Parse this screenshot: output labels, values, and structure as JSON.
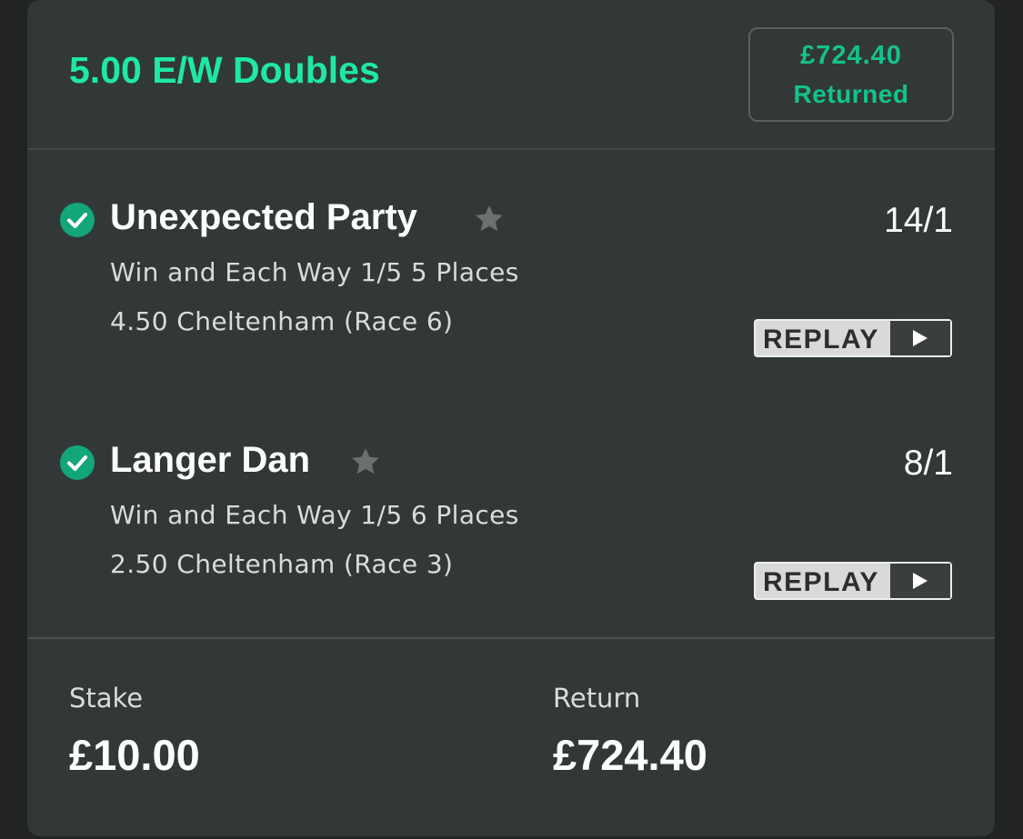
{
  "bet": {
    "title": "5.00 E/W Doubles",
    "returned_amount": "£724.40",
    "returned_label": "Returned"
  },
  "selections": [
    {
      "name": "Unexpected Party",
      "odds": "14/1",
      "market": "Win and Each Way 1/5 5 Places",
      "event": "4.50 Cheltenham (Race 6)",
      "replay_label": "REPLAY",
      "status": "won"
    },
    {
      "name": "Langer Dan",
      "odds": "8/1",
      "market": "Win and Each Way 1/5 6 Places",
      "event": "2.50 Cheltenham (Race 3)",
      "replay_label": "REPLAY",
      "status": "won"
    }
  ],
  "footer": {
    "stake_label": "Stake",
    "stake_value": "£10.00",
    "return_label": "Return",
    "return_value": "£724.40"
  },
  "colors": {
    "accent": "#1fe8a4",
    "badge_text": "#14c28a",
    "check": "#12a679",
    "card_bg": "#313837"
  }
}
